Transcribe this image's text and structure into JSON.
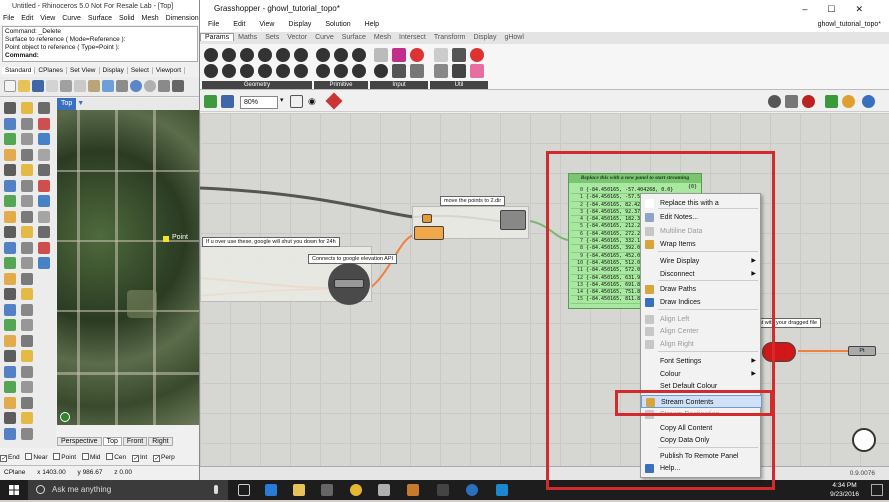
{
  "rhino": {
    "title": "Untitled - Rhinoceros 5.0 Not For Resale Lab - [Top]",
    "menu": [
      "File",
      "Edit",
      "View",
      "Curve",
      "Surface",
      "Solid",
      "Mesh",
      "Dimension"
    ],
    "command_lines": [
      "Command: _Delete",
      "Surface to reference ( Mode=Reference ):",
      "Point object to reference ( Type=Point ):",
      "Command:"
    ],
    "toolbar_tabs": [
      "Standard",
      "CPlanes",
      "Set View",
      "Display",
      "Select",
      "Viewport"
    ],
    "viewport_name": "Top",
    "point_label": "Point",
    "viewport_tabs": [
      "Perspective",
      "Top",
      "Front",
      "Right"
    ],
    "osnaps": [
      {
        "label": "End",
        "checked": true
      },
      {
        "label": "Near",
        "checked": false
      },
      {
        "label": "Point",
        "checked": false
      },
      {
        "label": "Mid",
        "checked": false
      },
      {
        "label": "Cen",
        "checked": false
      },
      {
        "label": "Int",
        "checked": true
      },
      {
        "label": "Perp",
        "checked": true
      }
    ],
    "status": {
      "cplane": "CPlane",
      "x": "x 1403.00",
      "y": "y 986.67",
      "z": "z 0.00"
    }
  },
  "gh": {
    "title": "Grasshopper - ghowl_tutorial_topo*",
    "menu": [
      "File",
      "Edit",
      "View",
      "Display",
      "Solution",
      "Help"
    ],
    "doc_name": "ghowl_tutorial_topo*",
    "tabs": [
      "Params",
      "Maths",
      "Sets",
      "Vector",
      "Curve",
      "Surface",
      "Mesh",
      "Intersect",
      "Transform",
      "Display",
      "gHowl"
    ],
    "ribbon_groups": [
      "Geometry",
      "Primitive",
      "Input",
      "Util"
    ],
    "zoom": "80%",
    "groups": {
      "move": "move the points to 2.dir",
      "google": "Connects to google elevation API",
      "warning": "If u over use these, google will shut you down for 24h",
      "dragged": "component with your dragged file"
    },
    "component_labels": {
      "vector_out": "Pt"
    },
    "version": "0.9.0076",
    "panel": {
      "title": "Replace this with a new panel to start streaming",
      "branch": "{0}",
      "rows": [
        {
          "index": "0",
          "value": "{-84.450165, -57.404268, 0.0}"
        },
        {
          "index": "1",
          "value": "{-84.450165, -57.5"
        },
        {
          "index": "2",
          "value": "{-84.450165, 82.42"
        },
        {
          "index": "3",
          "value": "{-84.450165, 92.37"
        },
        {
          "index": "4",
          "value": "{-84.450165, 182.3"
        },
        {
          "index": "5",
          "value": "{-84.450165, 212.2"
        },
        {
          "index": "6",
          "value": "{-84.450165, 272.2"
        },
        {
          "index": "7",
          "value": "{-84.450165, 332.1"
        },
        {
          "index": "8",
          "value": "{-84.450165, 392.0"
        },
        {
          "index": "9",
          "value": "{-84.450165, 452.0"
        },
        {
          "index": "10",
          "value": "{-84.450165, 512.0"
        },
        {
          "index": "11",
          "value": "{-84.450165, 572.0"
        },
        {
          "index": "12",
          "value": "{-84.450165, 631.9"
        },
        {
          "index": "13",
          "value": "{-84.450165, 691.8"
        },
        {
          "index": "14",
          "value": "{-84.450165, 751.8"
        },
        {
          "index": "15",
          "value": "{-84.450165, 811.8"
        }
      ]
    },
    "context_menu": {
      "items": [
        {
          "label": "Replace this with a",
          "disabled": false,
          "arrow": false,
          "icon": "#ffffff"
        },
        {
          "label": "Edit Notes...",
          "disabled": false,
          "arrow": false,
          "icon": "#8da4c7"
        },
        {
          "label": "Multiline Data",
          "disabled": true,
          "arrow": false,
          "icon": "#c7c7c7"
        },
        {
          "label": "Wrap Items",
          "disabled": false,
          "arrow": false,
          "icon": "#d7a53a"
        },
        {
          "label": "Wire Display",
          "disabled": false,
          "arrow": true,
          "icon": ""
        },
        {
          "label": "Disconnect",
          "disabled": false,
          "arrow": true,
          "icon": ""
        },
        {
          "label": "Draw Paths",
          "disabled": false,
          "arrow": false,
          "icon": "#d7a53a"
        },
        {
          "label": "Draw Indices",
          "disabled": false,
          "arrow": false,
          "icon": "#3a6ebf"
        },
        {
          "label": "Align Left",
          "disabled": true,
          "arrow": false,
          "icon": "#c7c7c7"
        },
        {
          "label": "Align Center",
          "disabled": true,
          "arrow": false,
          "icon": "#c7c7c7"
        },
        {
          "label": "Align Right",
          "disabled": true,
          "arrow": false,
          "icon": "#c7c7c7"
        },
        {
          "label": "Font Settings",
          "disabled": false,
          "arrow": true,
          "icon": ""
        },
        {
          "label": "Colour",
          "disabled": false,
          "arrow": true,
          "icon": ""
        },
        {
          "label": "Set Default Colour",
          "disabled": false,
          "arrow": false,
          "icon": ""
        },
        {
          "label": "Stream Contents",
          "disabled": false,
          "arrow": false,
          "icon": "#d7a53a",
          "highlighted": true
        },
        {
          "label": "Stream Destination",
          "disabled": true,
          "arrow": false,
          "icon": "#c7c7c7"
        },
        {
          "label": "Copy All Content",
          "disabled": false,
          "arrow": false,
          "icon": ""
        },
        {
          "label": "Copy Data Only",
          "disabled": false,
          "arrow": false,
          "icon": ""
        },
        {
          "label": "Publish To Remote Panel",
          "disabled": false,
          "arrow": false,
          "icon": ""
        },
        {
          "label": "Help...",
          "disabled": false,
          "arrow": false,
          "icon": "#3a6ebf"
        }
      ]
    }
  },
  "taskbar": {
    "search_placeholder": "Ask me anything",
    "time": "4:34 PM",
    "date": "9/23/2016"
  },
  "colors": {
    "annotation_red": "#d32b2b",
    "panel_green": "#a8e8a0",
    "highlight_blue": "#cfe0f7"
  }
}
